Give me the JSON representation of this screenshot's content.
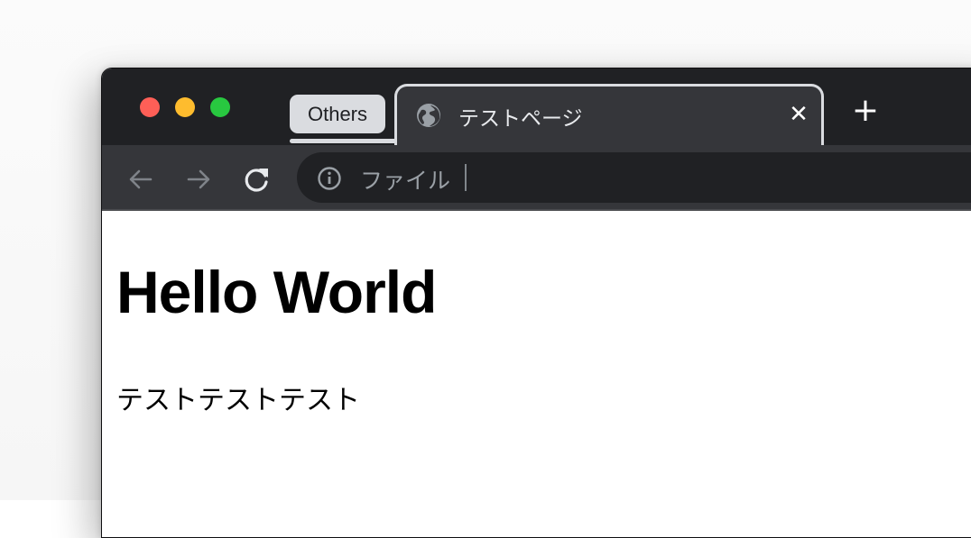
{
  "browser": {
    "tab_group": {
      "label": "Others",
      "color": "#dadce0"
    },
    "active_tab": {
      "title": "テストページ",
      "favicon": "globe-icon"
    },
    "close_glyph": "✕",
    "new_tab_glyph": "+",
    "toolbar": {
      "back": "arrow-left-icon",
      "forward": "arrow-right-icon",
      "reload": "reload-icon"
    },
    "omnibox": {
      "security_icon": "info-icon",
      "security_label": "ファイル"
    }
  },
  "page": {
    "heading": "Hello World",
    "paragraph": "テストテストテスト"
  },
  "colors": {
    "tabstrip": "#202124",
    "toolbar": "#35363a",
    "traffic_red": "#fe5f57",
    "traffic_yellow": "#febc2e",
    "traffic_green": "#28c840"
  }
}
